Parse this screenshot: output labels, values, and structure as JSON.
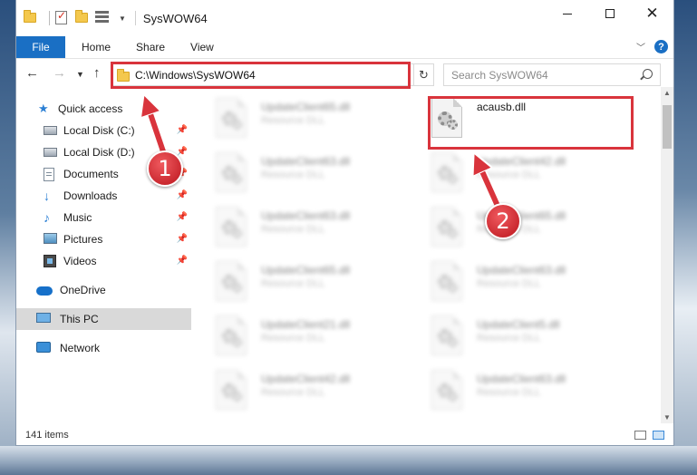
{
  "window": {
    "title": "SysWOW64"
  },
  "ribbon": {
    "tabs": [
      "File",
      "Home",
      "Share",
      "View"
    ]
  },
  "address": {
    "path": "C:\\Windows\\SysWOW64"
  },
  "search": {
    "placeholder": "Search SysWOW64"
  },
  "sidebar": {
    "items": [
      {
        "label": "Quick access",
        "icon": "star-icon",
        "pinned": false
      },
      {
        "label": "Local Disk (C:)",
        "icon": "drive-icon",
        "pinned": true
      },
      {
        "label": "Local Disk (D:)",
        "icon": "drive-icon",
        "pinned": true
      },
      {
        "label": "Documents",
        "icon": "documents-icon",
        "pinned": true
      },
      {
        "label": "Downloads",
        "icon": "downloads-icon",
        "pinned": true
      },
      {
        "label": "Music",
        "icon": "music-icon",
        "pinned": true
      },
      {
        "label": "Pictures",
        "icon": "pictures-icon",
        "pinned": true
      },
      {
        "label": "Videos",
        "icon": "videos-icon",
        "pinned": true
      },
      {
        "label": "OneDrive",
        "icon": "onedrive-icon",
        "pinned": false
      },
      {
        "label": "This PC",
        "icon": "this-pc-icon",
        "pinned": false,
        "selected": true
      },
      {
        "label": "Network",
        "icon": "network-icon",
        "pinned": false
      }
    ]
  },
  "files": {
    "highlighted": {
      "name": "acausb.dll",
      "description": ""
    },
    "left_column": [
      {
        "name": "UpdateClient65.dll",
        "description": "Resource DLL"
      },
      {
        "name": "UpdateClient63.dll",
        "description": "Resource DLL"
      },
      {
        "name": "UpdateClient63.dll",
        "description": "Resource DLL"
      },
      {
        "name": "UpdateClient65.dll",
        "description": "Resource DLL"
      },
      {
        "name": "UpdateClient21.dll",
        "description": "Resource DLL"
      },
      {
        "name": "UpdateClient42.dll",
        "description": "Resource DLL"
      }
    ],
    "right_column": [
      {
        "name": "UpdateClient42.dll",
        "description": "Resource DLL"
      },
      {
        "name": "UpdateClient65.dll",
        "description": "Resource DLL"
      },
      {
        "name": "UpdateClient63.dll",
        "description": "Resource DLL"
      },
      {
        "name": "UpdateClient5.dll",
        "description": "Resource DLL"
      },
      {
        "name": "UpdateClient63.dll",
        "description": "Resource DLL"
      }
    ]
  },
  "status": {
    "item_count": "141 items"
  },
  "annotations": {
    "step1": "1",
    "step2": "2",
    "color": "#d9343c"
  }
}
